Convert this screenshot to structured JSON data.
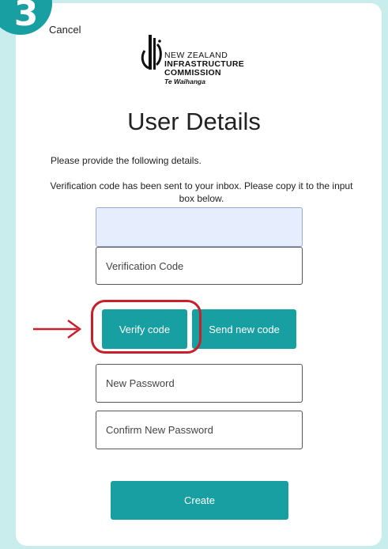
{
  "step": {
    "number": "3"
  },
  "header": {
    "cancel_label": "Cancel"
  },
  "logo": {
    "line1": "NEW ZEALAND",
    "line2": "INFRASTRUCTURE",
    "line3": "COMMISSION",
    "line4": "Te Waihanga"
  },
  "page": {
    "title": "User Details",
    "intro": "Please provide the following details.",
    "verification_message": "Verification code has been sent to your inbox. Please copy it to the input box below."
  },
  "form": {
    "email_value": "",
    "verification_code_placeholder": "Verification Code",
    "verify_button_label": "Verify code",
    "send_new_code_label": "Send new code",
    "new_password_placeholder": "New Password",
    "confirm_password_placeholder": "Confirm New Password",
    "create_button_label": "Create"
  },
  "colors": {
    "accent": "#189fa2",
    "background": "#c9ecec",
    "highlight": "#c8202a",
    "autofill": "#e6edfd"
  },
  "icons": {
    "step_badge": "step-number-badge",
    "annotation_arrow": "arrow-right-icon"
  }
}
